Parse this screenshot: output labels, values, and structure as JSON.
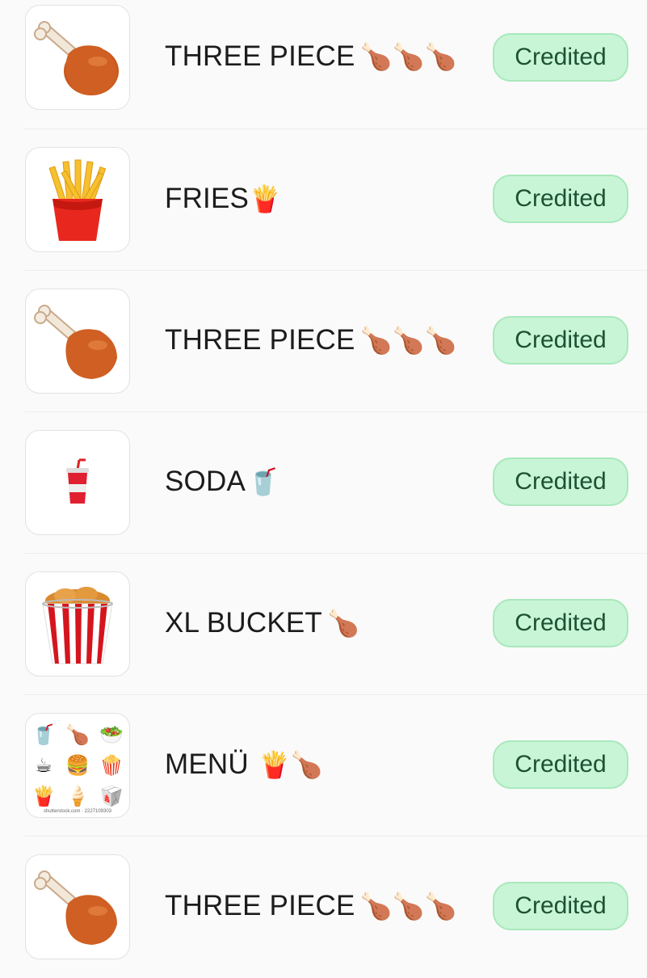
{
  "items": [
    {
      "title": "THREE PIECE",
      "emoji": "🍗🍗🍗",
      "status": "Credited",
      "icon": "chicken-leg-icon"
    },
    {
      "title": "FRIES",
      "emoji": "🍟",
      "status": "Credited",
      "icon": "fries-icon"
    },
    {
      "title": "THREE PIECE",
      "emoji": "🍗🍗🍗",
      "status": "Credited",
      "icon": "chicken-leg-icon"
    },
    {
      "title": "SODA",
      "emoji": "🥤",
      "status": "Credited",
      "icon": "soda-cup-icon"
    },
    {
      "title": "XL BUCKET",
      "emoji": "🍗",
      "status": "Credited",
      "icon": "chicken-bucket-icon"
    },
    {
      "title": "MENÜ",
      "emoji": "🍟🍗",
      "status": "Credited",
      "icon": "menu-collage-icon",
      "collage": [
        "🥤",
        "🍗",
        "🥗",
        "☕",
        "🍔",
        "🍿",
        "🍟",
        "🍦",
        "🥡"
      ],
      "watermark": "shutterstock.com · 2227109303"
    },
    {
      "title": "THREE PIECE",
      "emoji": "🍗🍗🍗",
      "status": "Credited",
      "icon": "chicken-leg-icon"
    }
  ],
  "colors": {
    "badge_bg": "#c8f5d6",
    "badge_text": "#1c5233",
    "chicken": "#c8561e"
  }
}
